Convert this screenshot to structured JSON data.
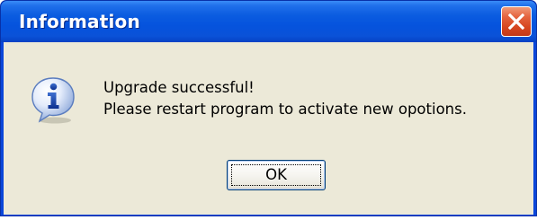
{
  "dialog": {
    "title": "Information",
    "close_icon": "close-icon",
    "message_icon": "information-icon",
    "message_line1": "Upgrade successful!",
    "message_line2": "Please restart program to activate new opotions.",
    "ok_label": "OK"
  },
  "colors": {
    "titlebar": "#0553dd",
    "client": "#ece9d8",
    "close_button": "#d6461f"
  }
}
